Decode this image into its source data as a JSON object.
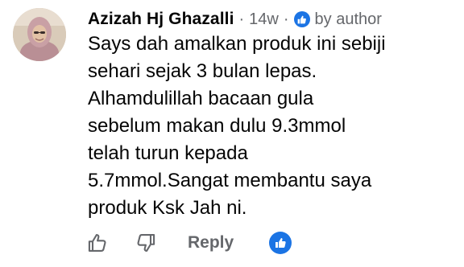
{
  "comment": {
    "author_name": "Azizah Hj Ghazalli",
    "time_ago": "14w",
    "separator": "·",
    "badge_label": "by author",
    "body_lines": [
      "Says dah amalkan produk ini sebiji",
      "sehari sejak 3 bulan lepas.",
      "Alhamdulillah bacaan gula",
      "sebelum makan dulu 9.3mmol",
      "telah turun kepada",
      "5.7mmol.Sangat membantu saya",
      "produk Ksk Jah ni."
    ]
  },
  "actions": {
    "like_icon": "thumbs-up-outline-icon",
    "dislike_icon": "thumbs-down-outline-icon",
    "reply_label": "Reply",
    "reaction_icon": "thumbs-up-filled-icon"
  },
  "colors": {
    "brand_blue": "#1b74e4",
    "meta_gray": "#65676b",
    "text": "#050505"
  }
}
